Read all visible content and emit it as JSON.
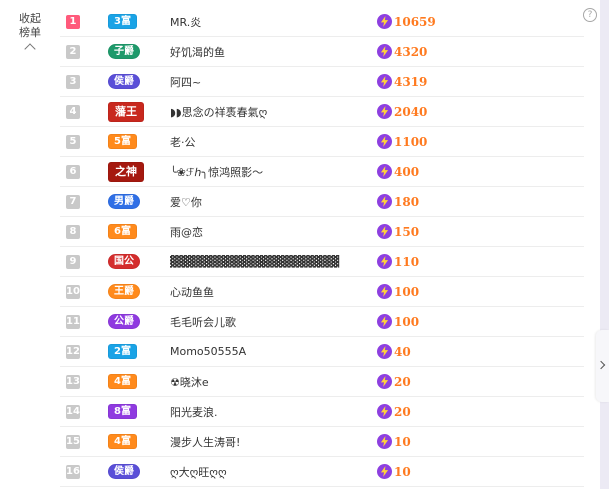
{
  "collapse": {
    "line1": "收起",
    "line2": "榜单"
  },
  "help": {
    "symbol": "?"
  },
  "rows": [
    {
      "rank": "1",
      "badge": "3富",
      "badge_color": "#1aa3e6",
      "name": "MR.炎",
      "score": "10659"
    },
    {
      "rank": "2",
      "badge": "子爵",
      "badge_color": "#1e9a6b",
      "name": "好饥渴的鱼",
      "score": "4320"
    },
    {
      "rank": "3",
      "badge": "侯爵",
      "badge_color": "#5a4fd8",
      "name": "阿四~",
      "score": "4319"
    },
    {
      "rank": "4",
      "badge": "藩王",
      "badge_color": "#c8281e",
      "name": "◗◗思念の祥褭春氣ღ",
      "score": "2040"
    },
    {
      "rank": "5",
      "badge": "5富",
      "badge_color": "#ff8a1c",
      "name": "老·公",
      "score": "1100"
    },
    {
      "rank": "6",
      "badge": "之神",
      "badge_color": "#a5190f",
      "name": "╰❀ℱℎ╮惊鸿照影～",
      "score": "400"
    },
    {
      "rank": "7",
      "badge": "男爵",
      "badge_color": "#2f6fe6",
      "name": "爱♡你",
      "score": "180"
    },
    {
      "rank": "8",
      "badge": "6富",
      "badge_color": "#ff8a1c",
      "name": "雨@恋",
      "score": "150"
    },
    {
      "rank": "9",
      "badge": "国公",
      "badge_color": "#d42d2d",
      "name": "▓▓▓▓▓▓▓▓▓▓▓▓▓▓▓▓▓▓▓▓",
      "score": "110"
    },
    {
      "rank": "10",
      "badge": "王爵",
      "badge_color": "#ff8a1c",
      "name": "心动鱼鱼",
      "score": "100"
    },
    {
      "rank": "11",
      "badge": "公爵",
      "badge_color": "#8f3ae0",
      "name": "毛毛听会儿歌",
      "score": "100"
    },
    {
      "rank": "12",
      "badge": "2富",
      "badge_color": "#1aa3e6",
      "name": "Momo50555A",
      "score": "40"
    },
    {
      "rank": "13",
      "badge": "4富",
      "badge_color": "#ff8a1c",
      "name": "☢晓沐e",
      "score": "20"
    },
    {
      "rank": "14",
      "badge": "8富",
      "badge_color": "#8f3ae0",
      "name": "阳光麦浪.",
      "score": "20"
    },
    {
      "rank": "15",
      "badge": "4富",
      "badge_color": "#ff8a1c",
      "name": "漫步人生涛哥!",
      "score": "10"
    },
    {
      "rank": "16",
      "badge": "侯爵",
      "badge_color": "#5a4fd8",
      "name": "ღ大ღ旺ღღ",
      "score": "10"
    }
  ],
  "icons": {
    "score": "lightning-bolt-icon",
    "collapse": "chevron-up-icon",
    "next": "chevron-right-icon"
  },
  "colors": {
    "score": "#ff7a1f",
    "bolt_bg": "#8d3fe0",
    "first_rank": "#ff5a7b"
  }
}
